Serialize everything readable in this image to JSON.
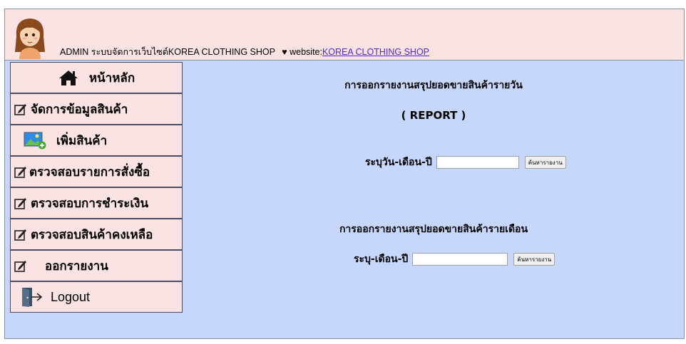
{
  "header": {
    "admin_text": "ADMIN ระบบจัดการเว็บไซต์KOREA CLOTHING SHOP",
    "heart": "♥",
    "website_label": "website:",
    "website_link": "KOREA CLOTHING SHOP"
  },
  "sidebar": {
    "items": [
      {
        "label": "หน้าหลัก",
        "icon": "home-icon"
      },
      {
        "label": "จัดการข้อมูลสินค้า",
        "icon": "edit-icon"
      },
      {
        "label": "เพิ่มสินค้า",
        "icon": "add-image-icon"
      },
      {
        "label": "ตรวจสอบรายการสั่งซื้อ",
        "icon": "edit-icon"
      },
      {
        "label": "ตรวจสอบการชำระเงิน",
        "icon": "edit-icon"
      },
      {
        "label": "ตรวจสอบสินค้าคงเหลือ",
        "icon": "edit-icon"
      },
      {
        "label": "ออกรายงาน",
        "icon": "edit-icon"
      },
      {
        "label": "Logout",
        "icon": "logout-door-icon"
      }
    ]
  },
  "main": {
    "daily_title": "การออกรายงานสรุปยอดขายสินค้ารายวัน",
    "report_label": "( REPORT )",
    "daily_field_label": "ระบุวัน-เดือน-ปี",
    "daily_input_value": "",
    "daily_button": "ค้นหารายงาน",
    "monthly_title": "การออกรายงานสรุปยอดขายสินค้ารายเดือน",
    "monthly_field_label": "ระบุ-เดือน-ปี",
    "monthly_input_value": "",
    "monthly_button": "ค้นหารายงาน"
  },
  "colors": {
    "header_bg": "#fbe3e3",
    "content_bg": "#c6d7fb",
    "sidebar_bg": "#fbe3e3",
    "link": "#4b2ad6"
  }
}
